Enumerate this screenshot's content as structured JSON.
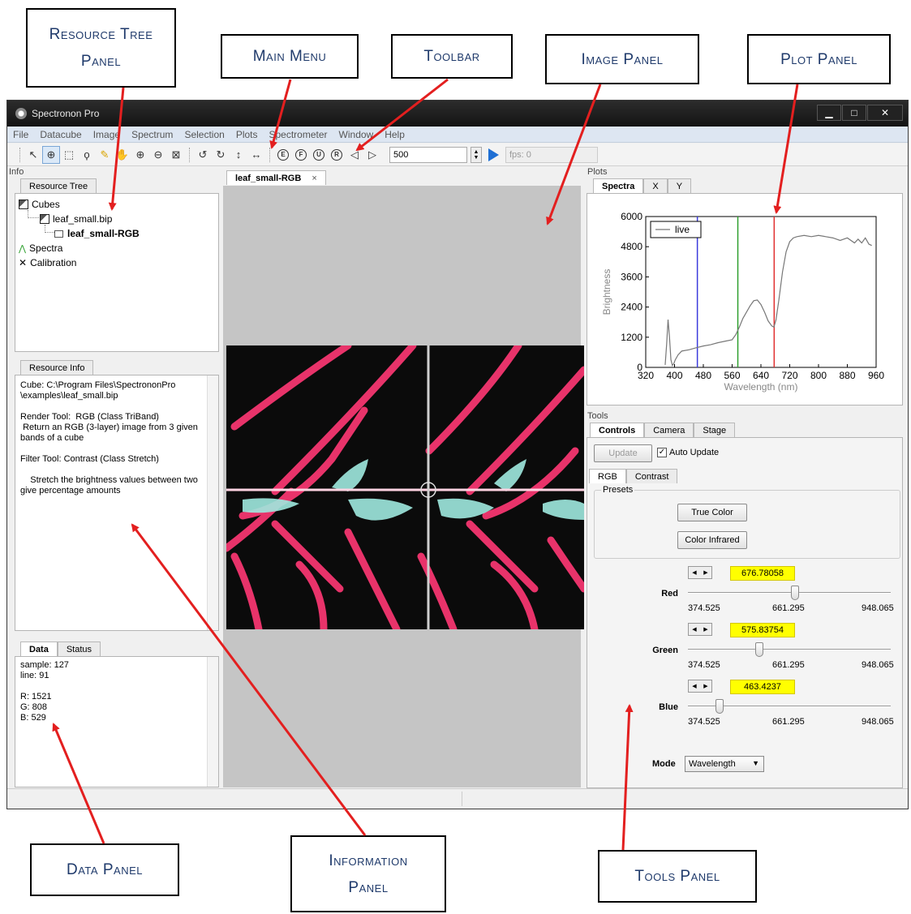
{
  "callouts": {
    "resource_tree": "Resource Tree Panel",
    "main_menu": "Main Menu",
    "toolbar": "Toolbar",
    "image_panel": "Image Panel",
    "plot_panel": "Plot Panel",
    "data_panel": "Data Panel",
    "information_panel": "Information Panel",
    "tools_panel": "Tools Panel"
  },
  "window": {
    "title": "Spectronon Pro",
    "controls": {
      "minimize": "▁",
      "maximize": "□",
      "close": "✕"
    }
  },
  "menu": [
    "File",
    "Datacube",
    "Image",
    "Spectrum",
    "Selection",
    "Plots",
    "Spectrometer",
    "Window",
    "Help"
  ],
  "toolbar": {
    "icons": [
      "pointer-icon",
      "crosshair-icon",
      "rect-select-icon",
      "lasso-icon",
      "wand-icon",
      "pan-hand-icon",
      "zoom-in-icon",
      "zoom-out-icon",
      "zoom-fit-icon",
      "rotate-ccw-icon",
      "rotate-cw-icon",
      "flip-vertical-icon",
      "flip-horizontal-icon",
      "e-icon",
      "f-icon",
      "u-icon",
      "r-icon",
      "prev-icon",
      "next-icon"
    ],
    "circle_letters": [
      "E",
      "F",
      "U",
      "R"
    ],
    "input_value": "500",
    "fps": "fps: 0"
  },
  "info_panel": {
    "header": "Info",
    "tree_tab": "Resource Tree",
    "tree": {
      "cubes": "Cubes",
      "file": "leaf_small.bip",
      "render": "leaf_small-RGB",
      "spectra": "Spectra",
      "calibration": "Calibration"
    },
    "resource_info_tab": "Resource Info",
    "resource_info_text": "Cube: C:\\Program Files\\SpectrononPro\n\\examples\\leaf_small.bip\n\nRender Tool:  RGB (Class TriBand)\n Return an RGB (3-layer) image from 3 given\nbands of a cube\n\nFilter Tool: Contrast (Class Stretch)\n\n    Stretch the brightness values between two\ngive percentage amounts",
    "data_tab": "Data",
    "status_tab": "Status",
    "data_text": "sample: 127\nline: 91\n\nR: 1521\nG: 808\nB: 529"
  },
  "image_panel": {
    "tab": "leaf_small-RGB",
    "close": "×"
  },
  "plots_panel": {
    "header": "Plots",
    "tabs": [
      "Spectra",
      "X",
      "Y"
    ]
  },
  "chart_data": {
    "type": "line",
    "title": "",
    "xlabel": "Wavelength (nm)",
    "ylabel": "Brightness",
    "xlim": [
      320,
      960
    ],
    "ylim": [
      0,
      6000
    ],
    "xticks": [
      320,
      400,
      480,
      560,
      640,
      720,
      800,
      880,
      960
    ],
    "yticks": [
      0,
      1200,
      2400,
      3600,
      4800,
      6000
    ],
    "legend": {
      "label": "live",
      "placement": "top-left"
    },
    "series": [
      {
        "name": "live",
        "color": "#777777",
        "x": [
          374,
          378,
          382,
          386,
          390,
          394,
          398,
          402,
          410,
          420,
          440,
          460,
          480,
          500,
          520,
          540,
          560,
          570,
          580,
          590,
          600,
          610,
          620,
          630,
          640,
          650,
          660,
          670,
          676,
          682,
          690,
          700,
          710,
          720,
          730,
          740,
          760,
          780,
          800,
          820,
          840,
          860,
          880,
          900,
          910,
          920,
          930,
          940,
          948
        ],
        "y": [
          100,
          900,
          1900,
          1200,
          300,
          80,
          150,
          300,
          500,
          650,
          700,
          780,
          850,
          900,
          980,
          1040,
          1100,
          1300,
          1600,
          1950,
          2200,
          2450,
          2650,
          2680,
          2500,
          2200,
          1850,
          1650,
          1600,
          1900,
          2700,
          3800,
          4600,
          5000,
          5150,
          5200,
          5250,
          5200,
          5250,
          5200,
          5150,
          5050,
          5150,
          4950,
          5100,
          4950,
          5150,
          4900,
          4850
        ]
      }
    ],
    "markers": [
      {
        "x": 463.4237,
        "color": "#3b3bdc"
      },
      {
        "x": 575.83754,
        "color": "#2ea02e"
      },
      {
        "x": 676.78058,
        "color": "#e03030"
      }
    ]
  },
  "tools_panel": {
    "header": "Tools",
    "tabs": [
      "Controls",
      "Camera",
      "Stage"
    ],
    "update_button": "Update",
    "auto_update_label": "Auto Update",
    "auto_update_checked": true,
    "sub_tabs": [
      "RGB",
      "Contrast"
    ],
    "presets_label": "Presets",
    "true_color_button": "True Color",
    "color_infrared_button": "Color Infrared",
    "sliders": [
      {
        "label": "Red",
        "value": "676.78058",
        "min": "374.525",
        "mid": "661.295",
        "max": "948.065",
        "fraction": 0.526
      },
      {
        "label": "Green",
        "value": "575.83754",
        "min": "374.525",
        "mid": "661.295",
        "max": "948.065",
        "fraction": 0.351
      },
      {
        "label": "Blue",
        "value": "463.4237",
        "min": "374.525",
        "mid": "661.295",
        "max": "948.065",
        "fraction": 0.155
      }
    ],
    "mode_label": "Mode",
    "mode_value": "Wavelength"
  }
}
